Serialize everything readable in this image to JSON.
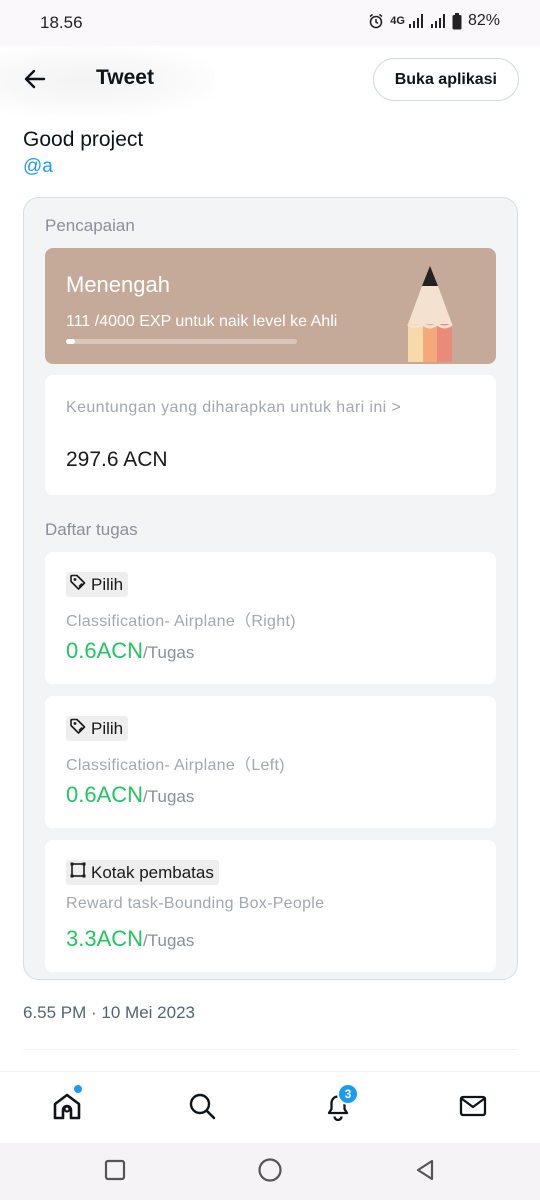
{
  "status_bar": {
    "time": "18.56",
    "network": "4G",
    "battery": "82%"
  },
  "header": {
    "title": "Tweet",
    "open_app_label": "Buka aplikasi"
  },
  "tweet": {
    "text": "Good project",
    "mention": "@a",
    "timestamp": "6.55 PM · 10 Mei 2023"
  },
  "card": {
    "achievement_label": "Pencapaian",
    "level": {
      "name": "Menengah",
      "exp_text": "111 /4000 EXP untuk naik level ke Ahli",
      "progress": 0.028
    },
    "profit": {
      "label": "Keuntungan yang diharapkan untuk hari ini >",
      "value": "297.6 ACN"
    },
    "tasks_label": "Daftar tugas",
    "tasks": [
      {
        "tag": "Pilih",
        "tag_icon": "tag-icon",
        "name": "Classification- Airplane（Right)",
        "amount": "0.6ACN",
        "unit": "/Tugas"
      },
      {
        "tag": "Pilih",
        "tag_icon": "tag-icon",
        "name": "Classification- Airplane（Left)",
        "amount": "0.6ACN",
        "unit": "/Tugas"
      },
      {
        "tag": "Kotak pembatas",
        "tag_icon": "bounding-box-icon",
        "name": "Reward task-Bounding Box-People",
        "amount": "3.3ACN",
        "unit": "/Tugas"
      }
    ]
  },
  "bottom_nav": {
    "items": [
      "home-icon",
      "search-icon",
      "bell-icon",
      "mail-icon"
    ],
    "notification_count": "3"
  },
  "colors": {
    "accent": "#1d9bf0",
    "level_bg": "#c5aa99",
    "reward_green": "#22c55e"
  }
}
